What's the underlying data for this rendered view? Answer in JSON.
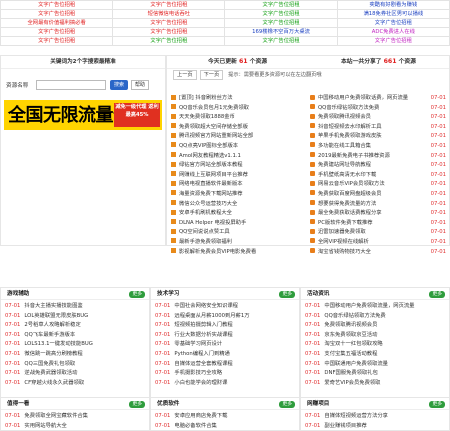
{
  "ads": [
    [
      {
        "t": "文字广告位招租",
        "c": "red"
      },
      {
        "t": "文字广告位招租",
        "c": "red"
      },
      {
        "t": "文字广告位招租",
        "c": "green"
      },
      {
        "t": "奕酷有好剧看为赚钱",
        "c": "blue"
      }
    ],
    [
      {
        "t": "文字广告位招租",
        "c": "red"
      },
      {
        "t": "短信微信电话吞吐",
        "c": "red"
      },
      {
        "t": "文字广告位招租",
        "c": "green"
      },
      {
        "t": "满18免券社区男可以播线",
        "c": "blue"
      }
    ],
    [
      {
        "t": "全网最有价值福利搞必看",
        "c": "red"
      },
      {
        "t": "文字广告位招租",
        "c": "red"
      },
      {
        "t": "文字广告位招租",
        "c": "green"
      },
      {
        "t": "文字广告位招租",
        "c": "blue"
      }
    ],
    [
      {
        "t": "文字广告位招租",
        "c": "red"
      },
      {
        "t": "文字广告位招租",
        "c": "red"
      },
      {
        "t": "169楼橡不空百万大桌流",
        "c": "blue"
      },
      {
        "t": "ADC免费进人在线",
        "c": "purple"
      }
    ],
    [
      {
        "t": "文字广告位招租",
        "c": "red"
      },
      {
        "t": "文字广告位招租",
        "c": "green"
      },
      {
        "t": "文字广告位招租",
        "c": "green"
      },
      {
        "t": "文字广告位招租",
        "c": "purple"
      }
    ]
  ],
  "search": {
    "heading": "关键词为2个字搜索最精准",
    "label": "资源名称",
    "placeholder": "",
    "button": "搜索",
    "help": "帮助"
  },
  "banner": {
    "main": "全国无限流量卡",
    "side": "减免一级代理 返利最高45%"
  },
  "stats": {
    "today_pre": "今天已更新",
    "today_num": "61",
    "today_post": "个资源",
    "total_pre": "本站一共分享了",
    "total_num": "661",
    "total_post": "个资源"
  },
  "pager": {
    "prev": "上一页",
    "next": "下一页",
    "hint": "提示：需要看更多资源可以在左边翻页哦"
  },
  "left_list": [
    "[置顶] 抖音刷粉丝方法",
    "QQ音乐会员包月1元免费领取",
    "天天免费领取1888金币",
    "免费领取超大空间存储全部版",
    "腾讯视频官方网站重新网站全部",
    "QQ点亮VIP图标全部版本",
    "Amol网友教程精选v1.1.1",
    "绿钻官方网站全部版本教程",
    "网赚线上互联网项目平台推荐",
    "网络电视直播软件最新版本",
    "海量资源免费下载网站推荐",
    "微信公众号运营技巧大全",
    "安卓手机刷机教程大全",
    "DLNA Helper 电视投屏助手",
    "QQ空间说说点赞工具",
    "最新手游免费领取福利",
    "影视解析免费会员VIP电影免费看"
  ],
  "right_list": [
    "中国移动用户免费领取话费，网页流量",
    "QQ音乐绿钻领取方法免费",
    "免费领取腾讯视频会员",
    "抖音短视频去水印解析工具",
    "苹果手机免费领取游戏皮肤",
    "多功能在线工具箱合集",
    "2019最新免费电子书推荐资源",
    "免费建站网址导航教程",
    "手机壁纸高清无水印下载",
    "网易云音乐VIP会员领取方法",
    "免费获取百度网盘超级会员",
    "想要获得免费流量的方法",
    "最全免费获取话费教程分享",
    "PC版软件免费下载推荐",
    "迅雷加速器免费领取",
    "全网VIP视频在线解析",
    "淘宝省钱购物技巧大全"
  ],
  "right_date": "07-01",
  "sections": [
    {
      "title": "游戏辅助",
      "more": "更多",
      "items": [
        "抖音大主播实播技能图鉴",
        "LOL英雄联盟无限皮肤BUG",
        "2号稻草人攻略解析稳定",
        "QQ飞车最新手游版本",
        "LOLS13.1一键发动技能BUG",
        "微信跳一跳高分刷榜教程",
        "QQ三国免费礼包领取",
        "逆战免费武器领取活动",
        "CF穿越火线永久武器领取"
      ]
    },
    {
      "title": "技术学习",
      "more": "更多",
      "items": [
        "中国社会网络安全知识课程",
        "远程桌面从月薪1000到月薪1万",
        "短视频拍摄剪辑入门教程",
        "行业大数据分析实战课程",
        "零基础学习网页设计",
        "Python编程入门到精通",
        "自媒体运营全套教程课程",
        "手机摄影技巧全攻略",
        "小白也能学会的理财课"
      ]
    },
    {
      "title": "活动资讯",
      "more": "更多",
      "items": [
        "中国移动用户免费领取流量，网页流量",
        "QQ音乐绿钻领取方法免费",
        "免费领取腾讯视频会员",
        "京东免费领取京豆活动",
        "淘宝双十一红包领取攻略",
        "支付宝集五福活动教程",
        "中国联通用户免费领取流量",
        "DNF国服免费领取礼包",
        "爱奇艺VIP会员免费领取"
      ]
    }
  ],
  "bottom_sections": [
    {
      "title": "值得一看",
      "more": "更多",
      "items": [
        "免费领取全网宝藏软件合集",
        "实用网站导航大全"
      ]
    },
    {
      "title": "优质软件",
      "more": "更多",
      "items": [
        "安卓应用商店免费下载",
        "电脑必备软件合集"
      ]
    },
    {
      "title": "网赚项目",
      "more": "更多",
      "items": [
        "自媒体短视频运营方法分享",
        "副业赚钱项目推荐"
      ]
    }
  ],
  "date": "07-01"
}
